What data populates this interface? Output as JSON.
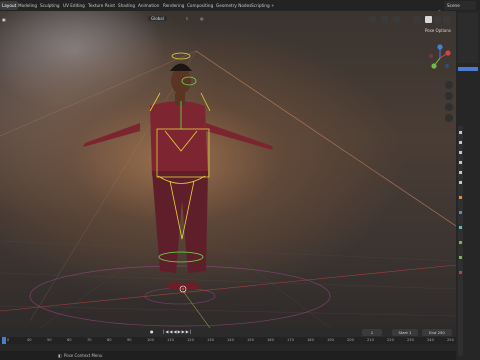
{
  "workspaces": {
    "items": [
      {
        "label": "Layout",
        "active": true
      },
      {
        "label": "Modeling"
      },
      {
        "label": "Sculpting"
      },
      {
        "label": "UV Editing"
      },
      {
        "label": "Texture Paint"
      },
      {
        "label": "Shading"
      },
      {
        "label": "Animation"
      },
      {
        "label": "Rendering"
      },
      {
        "label": "Compositing"
      },
      {
        "label": "Geometry Nodes"
      },
      {
        "label": "Scripting"
      }
    ]
  },
  "scene": {
    "name": "Scene"
  },
  "viewport": {
    "transform_orientation": "Global",
    "pose_options": "Pose Options"
  },
  "timeline": {
    "current_frame": "1",
    "start_label": "Start",
    "start_value": "1",
    "end_label": "End",
    "end_value": "250",
    "ruler_ticks": [
      "0",
      "40",
      "50",
      "60",
      "70",
      "80",
      "90",
      "100",
      "110",
      "120",
      "130",
      "140",
      "150",
      "160",
      "170",
      "180",
      "190",
      "200",
      "210",
      "220",
      "230",
      "240",
      "250"
    ]
  },
  "status": {
    "hint": "Pose Context Menu"
  },
  "colors": {
    "bone_yellow": "#e8d23a",
    "bone_green": "#6be04b",
    "ground_line": "#8a4a8a",
    "frame_cursor": "#4d7bd0"
  }
}
